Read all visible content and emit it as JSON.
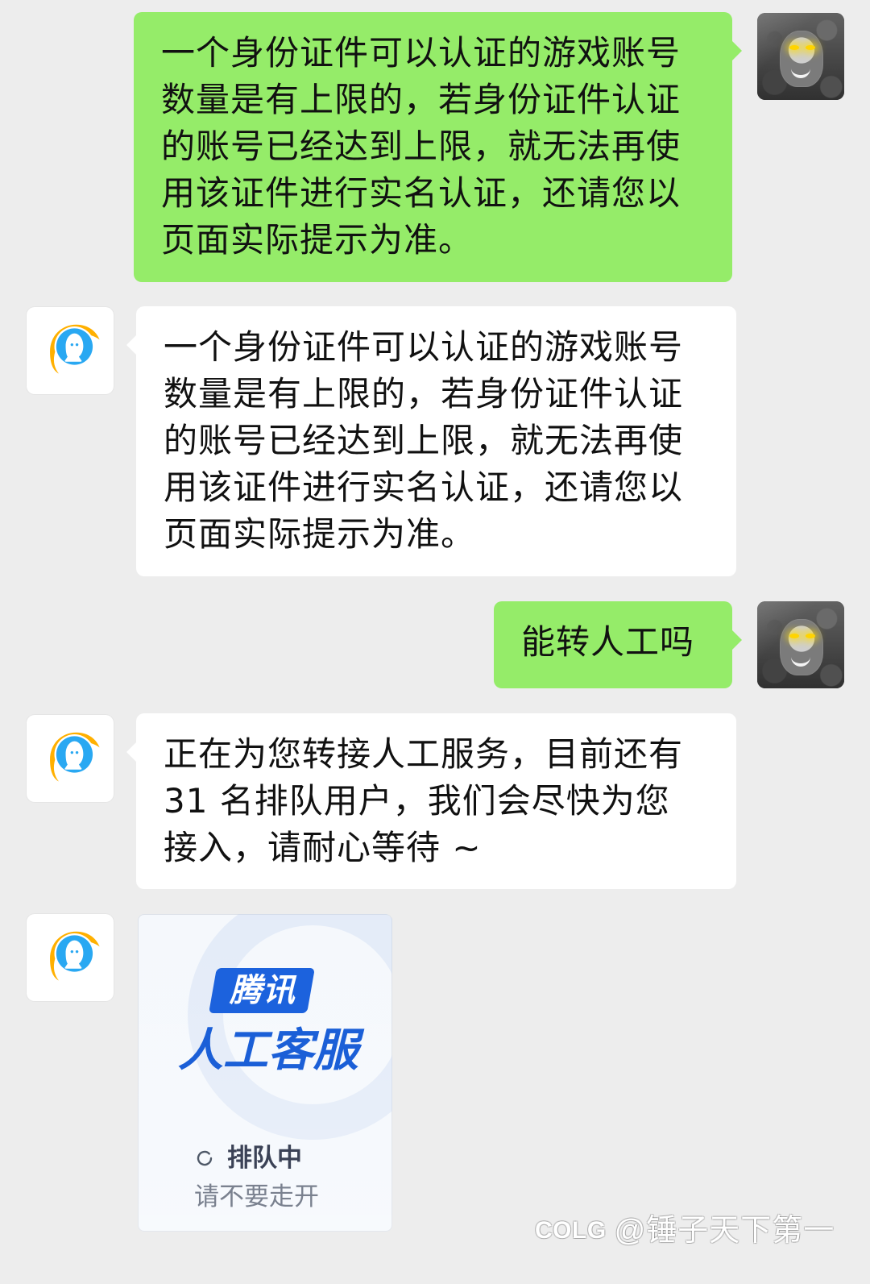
{
  "messages": [
    {
      "sender": "self",
      "type": "text",
      "text": "一个身份证件可以认证的游戏账号\n数量是有上限的，若身份证件认证\n的账号已经达到上限，就无法再使\n用该证件进行实名认证，还请您以\n页面实际提示为准。"
    },
    {
      "sender": "agent",
      "type": "text",
      "text": "一个身份证件可以认证的游戏账号\n数量是有上限的，若身份证件认证\n的账号已经达到上限，就无法再使\n用该证件进行实名认证，还请您以\n页面实际提示为准。"
    },
    {
      "sender": "self",
      "type": "text",
      "text": "能转人工吗"
    },
    {
      "sender": "agent",
      "type": "text",
      "text": "正在为您转接人工服务，目前还有\n31 名排队用户，我们会尽快为您\n接入，请耐心等待 ~"
    },
    {
      "sender": "agent",
      "type": "card",
      "brand": "腾讯",
      "title": "人工客服",
      "status": "排队中",
      "note": "请不要走开"
    }
  ],
  "icons": {
    "self_avatar": "user-avatar-icon",
    "agent_avatar": "qq-service-avatar-icon",
    "spinner": "loading-spinner-icon"
  },
  "colors": {
    "background": "#ededed",
    "self_bubble": "#95ec69",
    "agent_bubble": "#ffffff",
    "brand_blue": "#1b5fd7"
  },
  "watermark": {
    "logo": "COLG",
    "handle": "@锤子天下第一"
  }
}
